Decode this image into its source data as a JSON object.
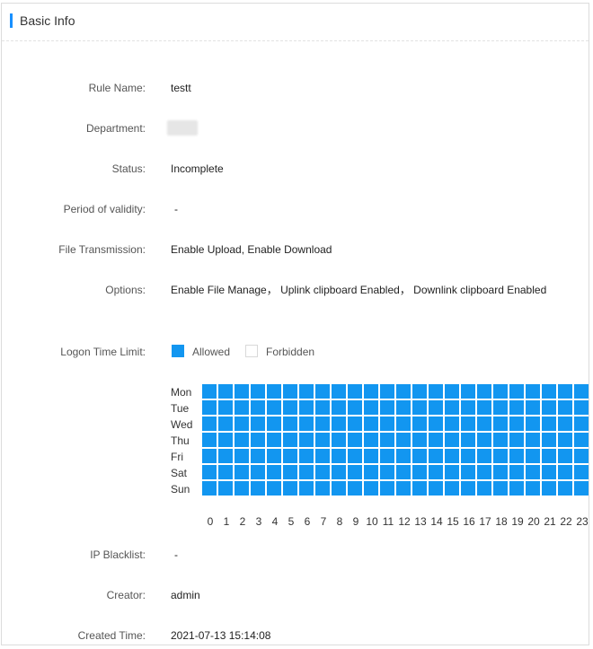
{
  "header": {
    "title": "Basic Info"
  },
  "fields": [
    {
      "key": "rule-name",
      "label": "Rule Name:",
      "value": "testt"
    },
    {
      "key": "department",
      "label": "Department:",
      "value": ""
    },
    {
      "key": "status",
      "label": "Status:",
      "value": "Incomplete"
    },
    {
      "key": "period",
      "label": "Period of validity:",
      "value": "-"
    },
    {
      "key": "file-transmission",
      "label": "File Transmission:",
      "value": "Enable Upload, Enable Download"
    },
    {
      "key": "options",
      "label": "Options:",
      "value": "Enable File Manage， Uplink clipboard Enabled， Downlink clipboard Enabled"
    }
  ],
  "logon": {
    "label": "Logon Time Limit:",
    "legend_allowed": "Allowed",
    "legend_forbidden": "Forbidden",
    "allowed_color": "#1296f0",
    "forbidden_color": "#ffffff",
    "days": [
      "Mon",
      "Tue",
      "Wed",
      "Thu",
      "Fri",
      "Sat",
      "Sun"
    ],
    "hours": [
      "0",
      "1",
      "2",
      "3",
      "4",
      "5",
      "6",
      "7",
      "8",
      "9",
      "10",
      "11",
      "12",
      "13",
      "14",
      "15",
      "16",
      "17",
      "18",
      "19",
      "20",
      "21",
      "22",
      "23"
    ],
    "allowed_all": true
  },
  "footer_fields": [
    {
      "key": "ip-blacklist",
      "label": "IP Blacklist:",
      "value": "-"
    },
    {
      "key": "creator",
      "label": "Creator:",
      "value": "admin"
    },
    {
      "key": "created-time",
      "label": "Created Time:",
      "value": "2021-07-13 15:14:08"
    }
  ]
}
